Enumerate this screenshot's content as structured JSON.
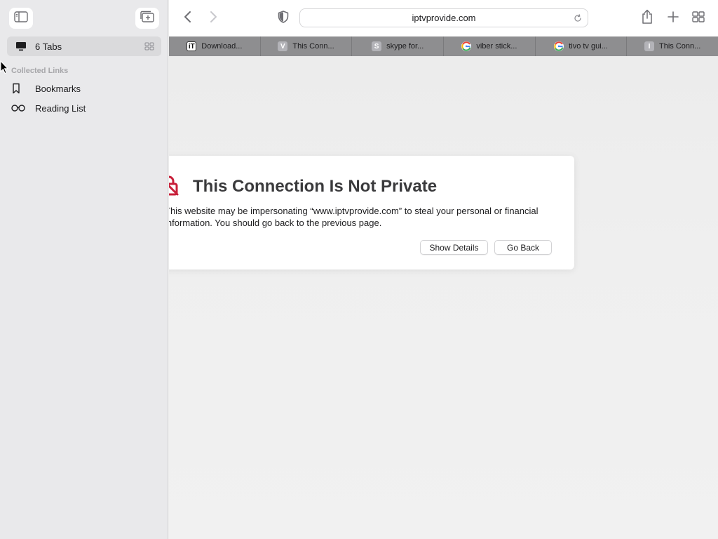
{
  "sidebar": {
    "tabs_label": "6 Tabs",
    "section_title": "Collected Links",
    "items": [
      {
        "label": "Bookmarks",
        "icon": "bookmark-icon"
      },
      {
        "label": "Reading List",
        "icon": "glasses-icon"
      }
    ]
  },
  "toolbar": {
    "url": "iptvprovide.com",
    "icons": [
      "sidebar-toggle-icon",
      "new-tab-group-icon",
      "chevron-left-icon",
      "chevron-right-icon",
      "privacy-shield-icon",
      "reload-icon",
      "share-icon",
      "plus-icon",
      "tab-overview-icon"
    ]
  },
  "tabs": [
    {
      "title": "Download...",
      "favicon": "iT",
      "favicon_type": "it"
    },
    {
      "title": "This Conn...",
      "favicon": "V",
      "favicon_type": "letter"
    },
    {
      "title": "skype for...",
      "favicon": "S",
      "favicon_type": "letter"
    },
    {
      "title": "viber stick...",
      "favicon": "G",
      "favicon_type": "g"
    },
    {
      "title": "tivo tv gui...",
      "favicon": "G",
      "favicon_type": "g"
    },
    {
      "title": "This Conn...",
      "favicon": "I",
      "favicon_type": "letter"
    }
  ],
  "warning": {
    "title": "This Connection Is Not Private",
    "body": "This website may be impersonating “www.iptvprovide.com” to steal your personal or financial information. You should go back to the previous page.",
    "show_details_label": "Show Details",
    "go_back_label": "Go Back",
    "icon_color": "#c8203a"
  },
  "colors": {
    "sidebar_bg": "#e9e9eb",
    "tabbar_bg": "#8e8e90",
    "content_bg": "#efefef"
  }
}
